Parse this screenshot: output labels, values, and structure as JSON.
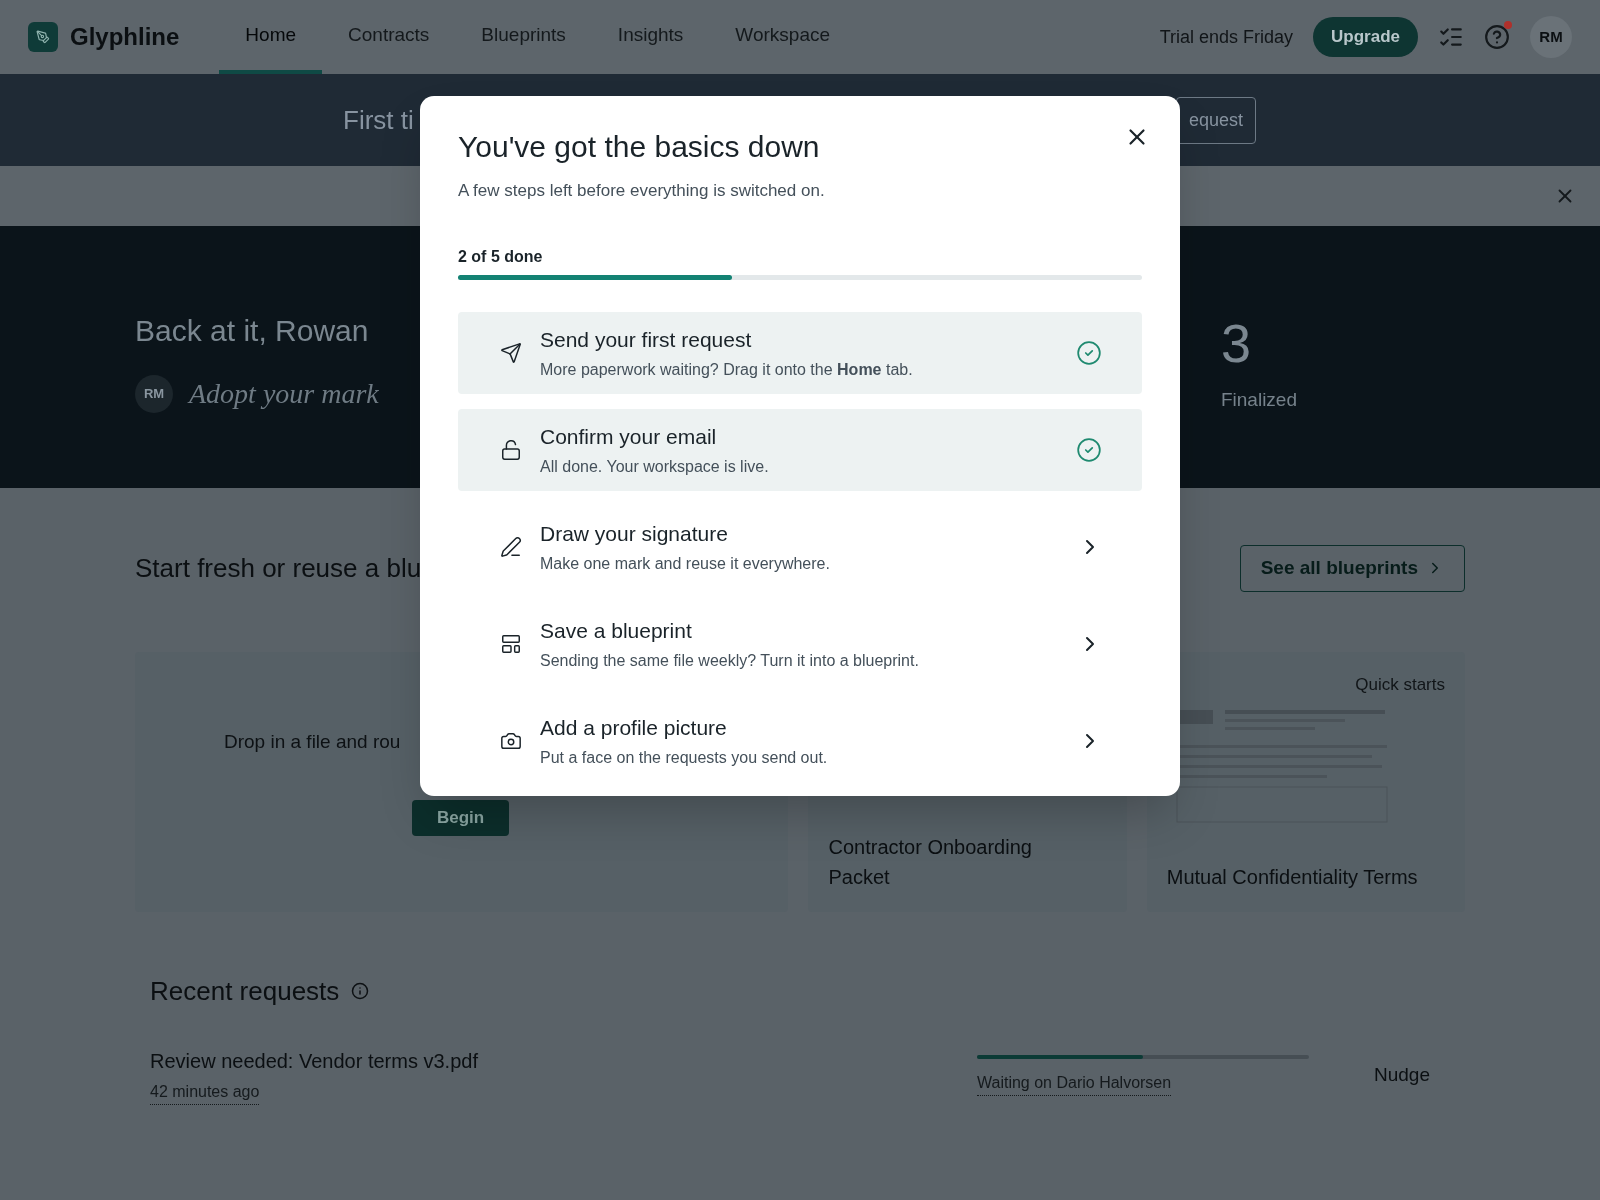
{
  "nav": {
    "brand": "Glyphline",
    "tabs": [
      {
        "label": "Home",
        "selected": true
      },
      {
        "label": "Contracts",
        "selected": false
      },
      {
        "label": "Blueprints",
        "selected": false
      },
      {
        "label": "Insights",
        "selected": false
      },
      {
        "label": "Workspace",
        "selected": false
      }
    ],
    "trial": "Trial ends Friday",
    "upgrade": "Upgrade",
    "help_notification": true,
    "avatar": "RM"
  },
  "banner": {
    "text": "First ti",
    "button": "equest"
  },
  "hero": {
    "greeting": "Back at it, Rowan",
    "avatar": "RM",
    "signature": "Adopt your mark",
    "stat": {
      "value": "3",
      "label": "Finalized"
    }
  },
  "templates": {
    "title": "Start fresh or reuse a blu",
    "see_all": "See all blueprints",
    "upload": {
      "text": "Drop in a file and rou",
      "button": "Begin"
    },
    "cards": [
      {
        "title": "Contractor Onboarding Packet"
      },
      {
        "title": "Mutual Confidentiality Terms",
        "tag": "Quick starts"
      }
    ]
  },
  "recent": {
    "title": "Recent requests",
    "rows": [
      {
        "name": "Review needed: Vendor terms v3.pdf",
        "time": "42 minutes ago",
        "level": 0.5,
        "status": "Waiting on Dario Halvorsen",
        "action": "Nudge"
      }
    ]
  },
  "modal": {
    "title": "You've got the basics down",
    "subtitle": "A few steps left before everything is switched on.",
    "progress_label": "2 of 5 done",
    "level": 0.4,
    "steps": [
      {
        "title": "Send your first request",
        "description": "More paperwork waiting? Drag it onto the **Home** tab.",
        "done": true
      },
      {
        "title": "Confirm your email",
        "description": "All done. Your workspace is live.",
        "done": true
      },
      {
        "title": "Draw your signature",
        "description": "Make one mark and reuse it everywhere.",
        "done": false
      },
      {
        "title": "Save a blueprint",
        "description": "Sending the same file weekly? Turn it into a blueprint.",
        "done": false
      },
      {
        "title": "Add a profile picture",
        "description": "Put a face on the requests you send out.",
        "done": false
      }
    ]
  }
}
